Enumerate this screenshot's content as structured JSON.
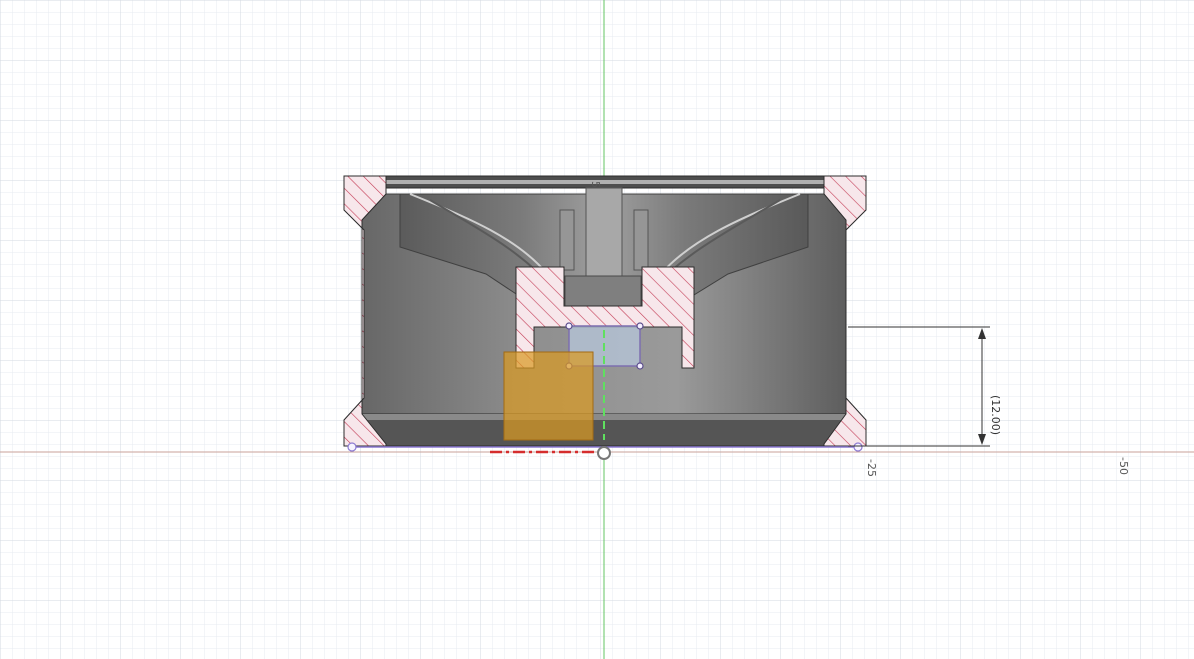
{
  "viewport": {
    "axis_labels": [
      "-25",
      "-50"
    ],
    "small_label": "5"
  },
  "sketch": {
    "dimension_label": "(12.00)"
  },
  "colors": {
    "grid_minor": "#e7ebf0",
    "grid_major": "#d3d9e1",
    "horizontal_axis": "#c9a29a",
    "vertical_axis": "#63c563",
    "hatch_fill": "#f7e7eb",
    "hatch_line": "#c43b55",
    "body_dark": "#4b4b4b",
    "body_mid": "#8f8f8f",
    "selection": "#b7c7db",
    "selection_edge": "#7d6fb0",
    "highlight": "#d99a22",
    "construction_red": "#d52d2d"
  }
}
